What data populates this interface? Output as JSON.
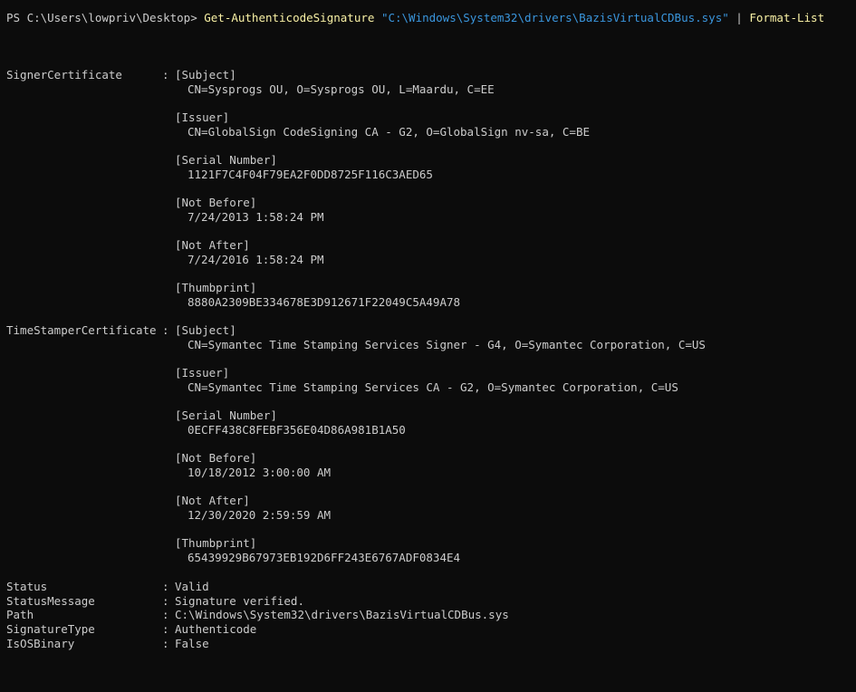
{
  "prompt": {
    "prefix": "PS C:\\Users\\lowpriv\\Desktop> ",
    "cmdlet": "Get-AuthenticodeSignature",
    "argument": "\"C:\\Windows\\System32\\drivers\\BazisVirtualCDBus.sys\"",
    "pipe": " | ",
    "pipe_cmd": "Format-List"
  },
  "signer": {
    "label": "SignerCertificate",
    "sep": ":",
    "subject_h": "[Subject]",
    "subject": "CN=Sysprogs OU, O=Sysprogs OU, L=Maardu, C=EE",
    "issuer_h": "[Issuer]",
    "issuer": "CN=GlobalSign CodeSigning CA - G2, O=GlobalSign nv-sa, C=BE",
    "serial_h": "[Serial Number]",
    "serial": "1121F7C4F04F79EA2F0DD8725F116C3AED65",
    "nb_h": "[Not Before]",
    "nb": "7/24/2013 1:58:24 PM",
    "na_h": "[Not After]",
    "na": "7/24/2016 1:58:24 PM",
    "thumb_h": "[Thumbprint]",
    "thumb": "8880A2309BE334678E3D912671F22049C5A49A78"
  },
  "ts": {
    "label": "TimeStamperCertificate",
    "sep": ":",
    "subject_h": "[Subject]",
    "subject": "CN=Symantec Time Stamping Services Signer - G4, O=Symantec Corporation, C=US",
    "issuer_h": "[Issuer]",
    "issuer": "CN=Symantec Time Stamping Services CA - G2, O=Symantec Corporation, C=US",
    "serial_h": "[Serial Number]",
    "serial": "0ECFF438C8FEBF356E04D86A981B1A50",
    "nb_h": "[Not Before]",
    "nb": "10/18/2012 3:00:00 AM",
    "na_h": "[Not After]",
    "na": "12/30/2020 2:59:59 AM",
    "thumb_h": "[Thumbprint]",
    "thumb": "65439929B67973EB192D6FF243E6767ADF0834E4"
  },
  "props": [
    {
      "label": "Status",
      "sep": ":",
      "value": "Valid"
    },
    {
      "label": "StatusMessage",
      "sep": ":",
      "value": "Signature verified."
    },
    {
      "label": "Path",
      "sep": ":",
      "value": "C:\\Windows\\System32\\drivers\\BazisVirtualCDBus.sys"
    },
    {
      "label": "SignatureType",
      "sep": ":",
      "value": "Authenticode"
    },
    {
      "label": "IsOSBinary",
      "sep": ":",
      "value": "False"
    }
  ]
}
